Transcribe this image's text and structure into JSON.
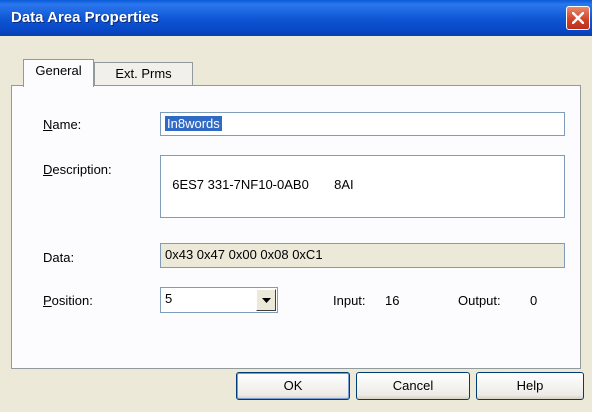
{
  "window": {
    "title": "Data Area Properties"
  },
  "tabs": [
    {
      "label": "General",
      "selected": true
    },
    {
      "label": "Ext. Prms",
      "selected": false
    }
  ],
  "general": {
    "name_label": "Name:",
    "name_value": "In8words",
    "description_label": "Description:",
    "description_value": "6ES7 331-7NF10-0AB0       8AI",
    "data_label": "Data:",
    "data_value": "0x43 0x47 0x00 0x08 0xC1",
    "position_label": "Position:",
    "position_value": "5",
    "input_label": "Input:",
    "input_value": "16",
    "output_label": "Output:",
    "output_value": "0"
  },
  "buttons": {
    "ok": "OK",
    "cancel": "Cancel",
    "help": "Help"
  },
  "icons": {
    "close": "close-icon",
    "dropdown": "chevron-down-icon"
  },
  "colors": {
    "titlebar": "#0a52d6",
    "close": "#d2452b",
    "selection": "#316ac5",
    "face": "#ece9d8"
  }
}
